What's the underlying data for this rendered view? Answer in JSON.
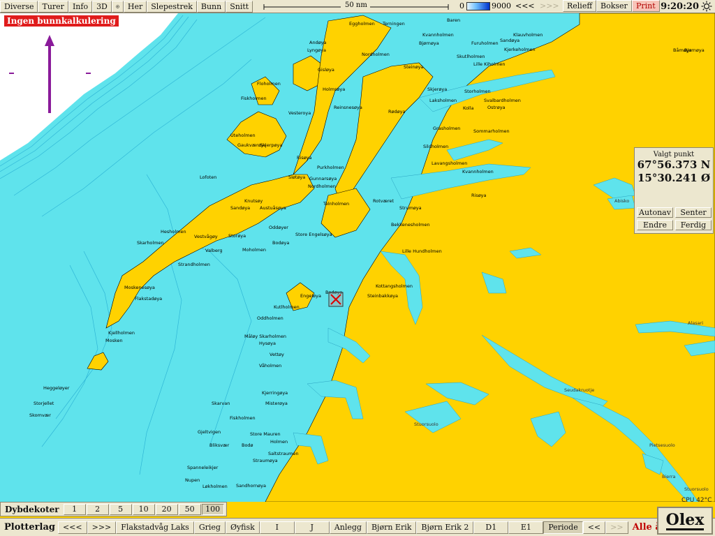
{
  "toolbar": {
    "diverse": "Diverse",
    "turer": "Turer",
    "info": "Info",
    "three_d": "3D",
    "her": "Her",
    "slepestrek": "Slepestrek",
    "bunn": "Bunn",
    "snitt": "Snitt",
    "scale_label": "50 nm",
    "depth_min": "0",
    "depth_max": "9000",
    "back": "<<<",
    "forward": ">>>",
    "relieff": "Relieff",
    "bokser": "Bokser",
    "print": "Print",
    "time": "9:20:20"
  },
  "warning": "Ingen bunnkalkulering",
  "selected_point": {
    "title": "Valgt punkt",
    "lat": "67°56.373 N",
    "lon": "15°30.241 Ø",
    "autonav": "Autonav",
    "senter": "Senter",
    "endre": "Endre",
    "ferdig": "Ferdig"
  },
  "cpu": "CPU 42°C",
  "depth_contours": {
    "title": "Dybdekoter",
    "values": [
      "1",
      "2",
      "5",
      "10",
      "20",
      "50",
      "100"
    ],
    "selected": "100"
  },
  "plotterlag": {
    "title": "Plotterlag",
    "back": "<<<",
    "forward": ">>>",
    "layers": [
      "Flakstadvåg Laks",
      "Grieg",
      "Øyfisk",
      "I",
      "J",
      "Anlegg",
      "Bjørn Erik",
      "Bjørn Erik 2",
      "D1",
      "E1"
    ],
    "periode": "Periode",
    "prev": "<<",
    "next": ">>",
    "all_years": "Alle år"
  },
  "logo": "Olex",
  "map_labels": [
    "Eggholmen",
    "Terningen",
    "Baren",
    "Klauvholmen",
    "Kvannholmen",
    "Bjørnøya",
    "Furuholmen",
    "Sandøya",
    "Båmøya",
    "Lyngøya",
    "Andøya",
    "Nordholmen",
    "Kjerkeholmen",
    "Skutlholmen",
    "Lille Kiholmen",
    "Floholmen",
    "Gisløya",
    "Holmsøya",
    "Steinøya",
    "Skjerøya",
    "Storholmen",
    "Ostrøya",
    "Svalbardholmen",
    "Laksholmen",
    "Kolla",
    "Fiskholmen",
    "Vesteroya",
    "Reinsnesøya",
    "Rødøya",
    "Uteholmen",
    "Gaukværøya",
    "Skjerpøya",
    "Grasholmen",
    "Sommarholmen",
    "Sildholmen",
    "Risøya",
    "Lavangsholmen",
    "Kvannholmen",
    "Lofoten",
    "Purkholmen",
    "Sløtøya",
    "Gunnarsøya",
    "Nordholmen",
    "Risøya",
    "Sandøya",
    "Knutsøy",
    "Austuåsøya",
    "Telnholmen",
    "Rotværet",
    "Strumøya",
    "Hesholmen",
    "Vestvågøy",
    "Storøya",
    "Oddøyer",
    "Store Engelsøya",
    "Bekkenesholmen",
    "Skarholmen",
    "Valberg",
    "Moholmen",
    "Bodøya",
    "Lille Hundholmen",
    "Strandholmen",
    "Moskenesøya",
    "Kottangsholmen",
    "Steinbakkøya",
    "Flakstadøya",
    "Engeløya",
    "Bodøya",
    "Kjellholmen",
    "Mosken",
    "Kutlholmen",
    "Oddholmen",
    "Måløy Skarholmen",
    "Hysøya",
    "Vettøy",
    "Våholmen",
    "Kjerringøya",
    "Misterøya",
    "Heggeløyer",
    "Storjellet",
    "Skomvær",
    "Skarvan",
    "Gjeltvigen",
    "Fiskholmen",
    "Store Mauren",
    "Holmen",
    "Bliksvær",
    "Bodø",
    "Saltstraumen",
    "Spanneleikjer",
    "Straumøya",
    "Nupen",
    "Løkholmen",
    "Sandhornøya",
    "Bjørnøya",
    "Abisko",
    "Alasari",
    "Seudakruotje",
    "Stuorsuolo",
    "Pietsesuolo",
    "Bierra",
    "Stuorsuolo",
    "Pietsesuolo"
  ]
}
